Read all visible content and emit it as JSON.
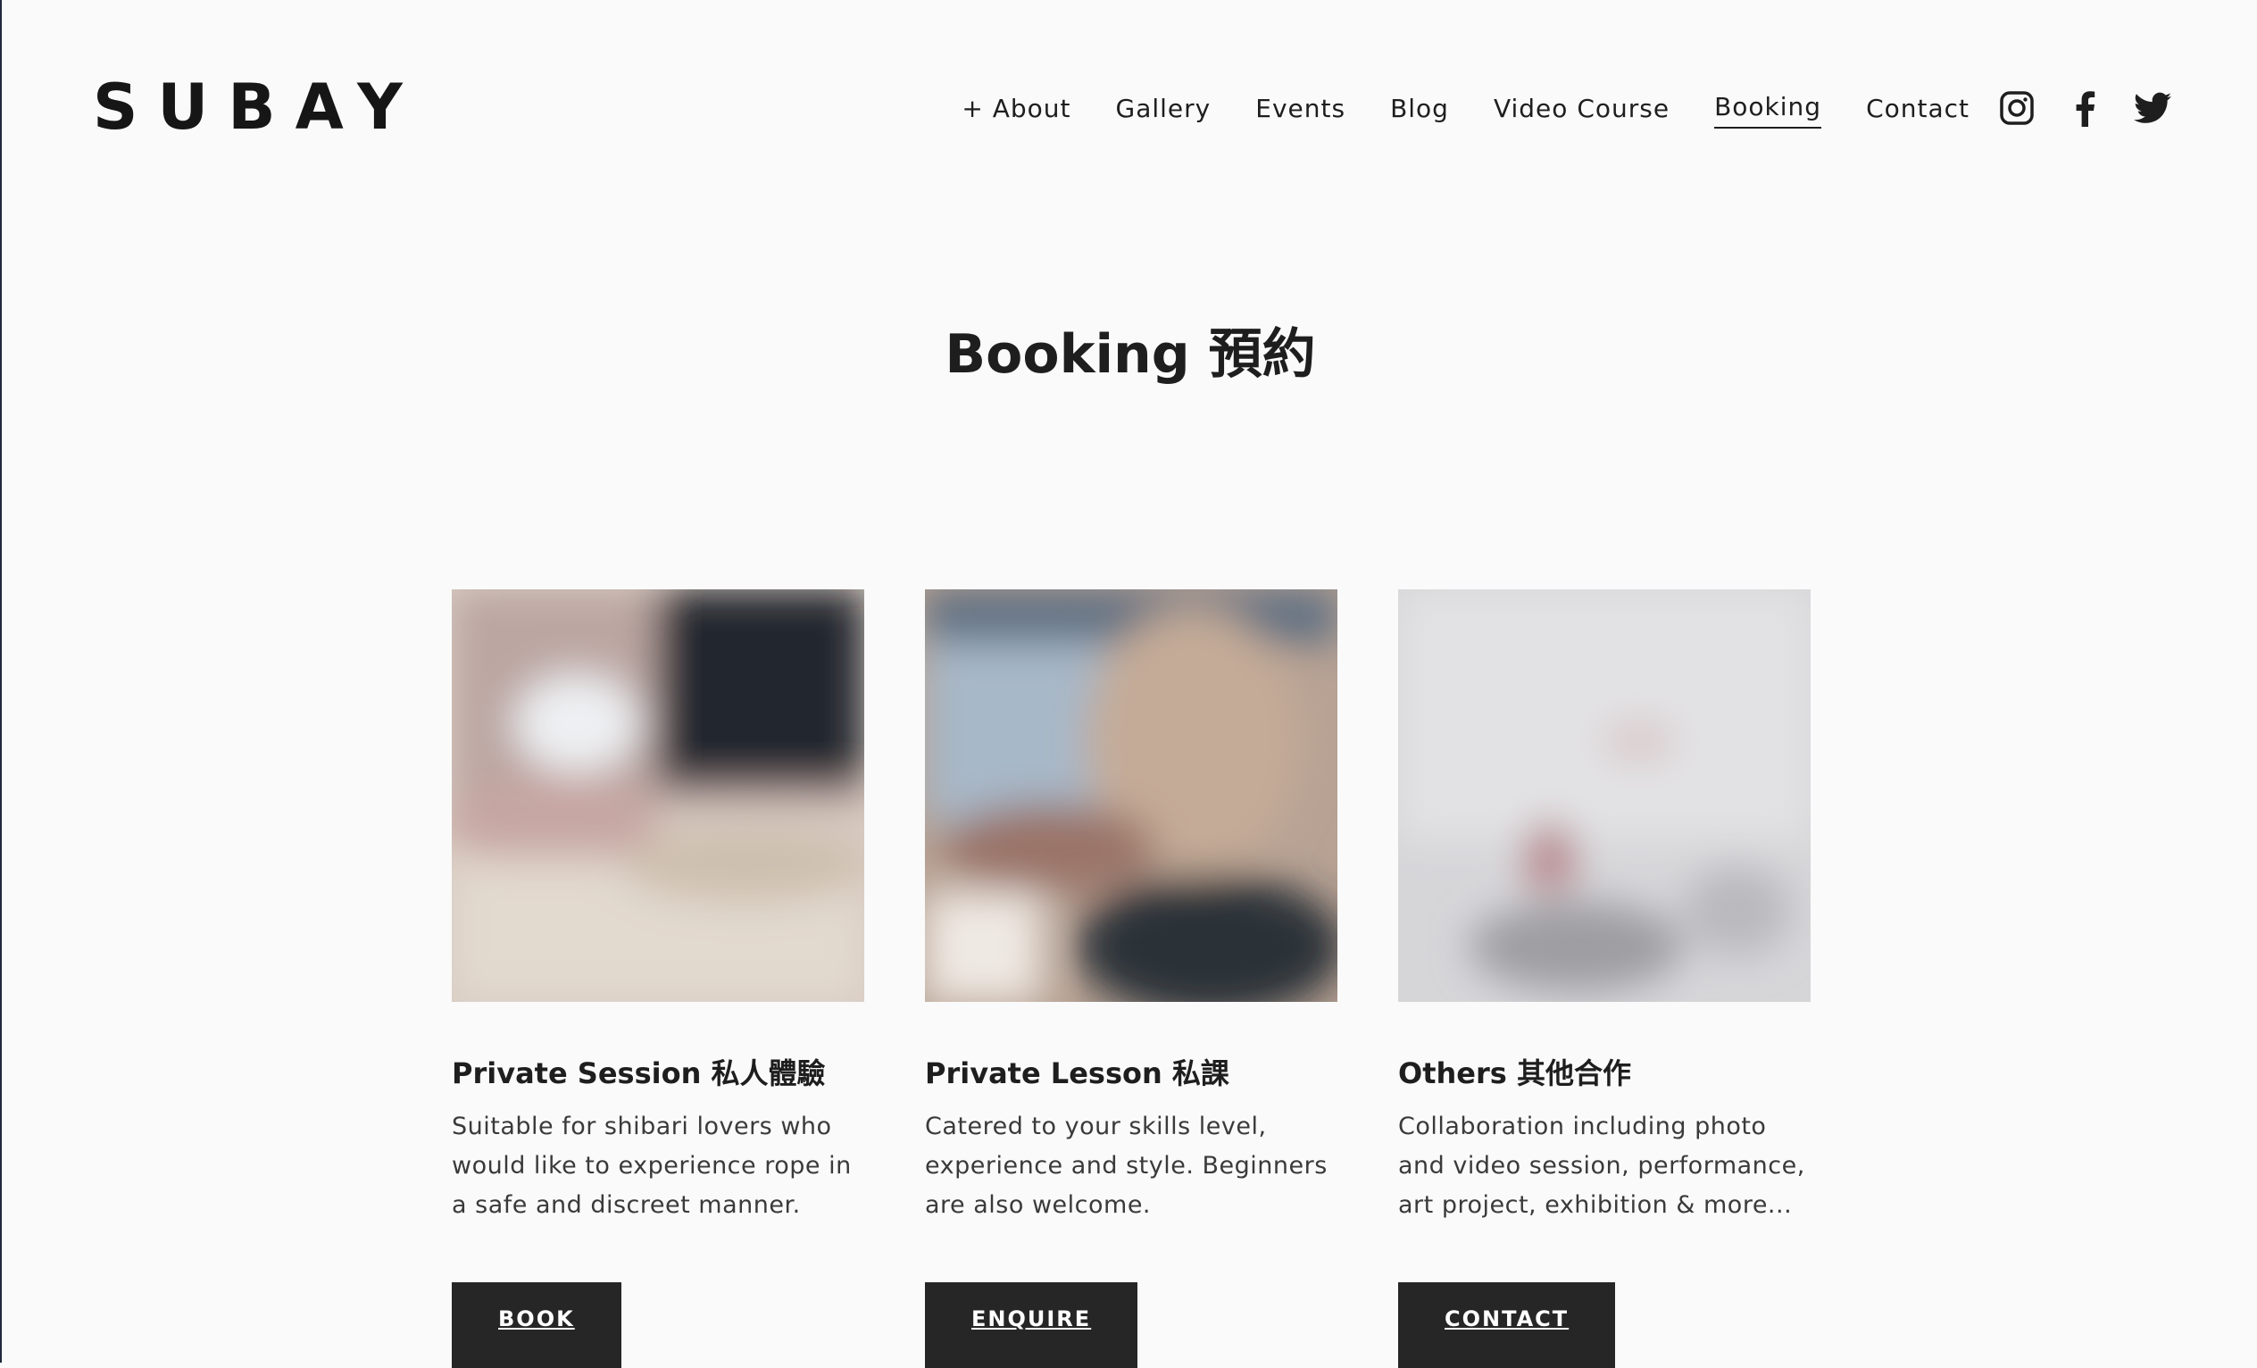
{
  "header": {
    "logo": "SUBAY",
    "nav": [
      {
        "label": "+ About"
      },
      {
        "label": "Gallery"
      },
      {
        "label": "Events"
      },
      {
        "label": "Blog"
      },
      {
        "label": "Video Course"
      },
      {
        "label": "Booking",
        "active": true
      },
      {
        "label": "Contact"
      }
    ],
    "social": [
      {
        "icon": "instagram-icon"
      },
      {
        "icon": "facebook-icon"
      },
      {
        "icon": "twitter-icon"
      }
    ]
  },
  "main": {
    "title": "Booking  預約",
    "cards": [
      {
        "title": "Private Session 私人體驗",
        "description": "Suitable for shibari lovers who would like to experience rope in a safe and discreet manner.",
        "button": "BOOK",
        "image_colors": [
          "#c9b2ad",
          "#222831",
          "#e4dcd3"
        ]
      },
      {
        "title": "Private Lesson 私課",
        "description": "Catered to your skills level, experience and style. Beginners are also welcome.",
        "button": "ENQUIRE",
        "image_colors": [
          "#a9b7c6",
          "#b89e88",
          "#2a2d33"
        ]
      },
      {
        "title": "Others 其他合作",
        "description": "Collaboration including photo and video session, performance, art project, exhibition & more...",
        "button": "CONTACT",
        "image_colors": [
          "#dcdcde",
          "#c3a0a4",
          "#9b9b9f"
        ]
      }
    ]
  },
  "colors": {
    "background": "#fafafa",
    "text": "#1e1e1e",
    "button_bg": "#262626",
    "button_text": "#ffffff"
  }
}
